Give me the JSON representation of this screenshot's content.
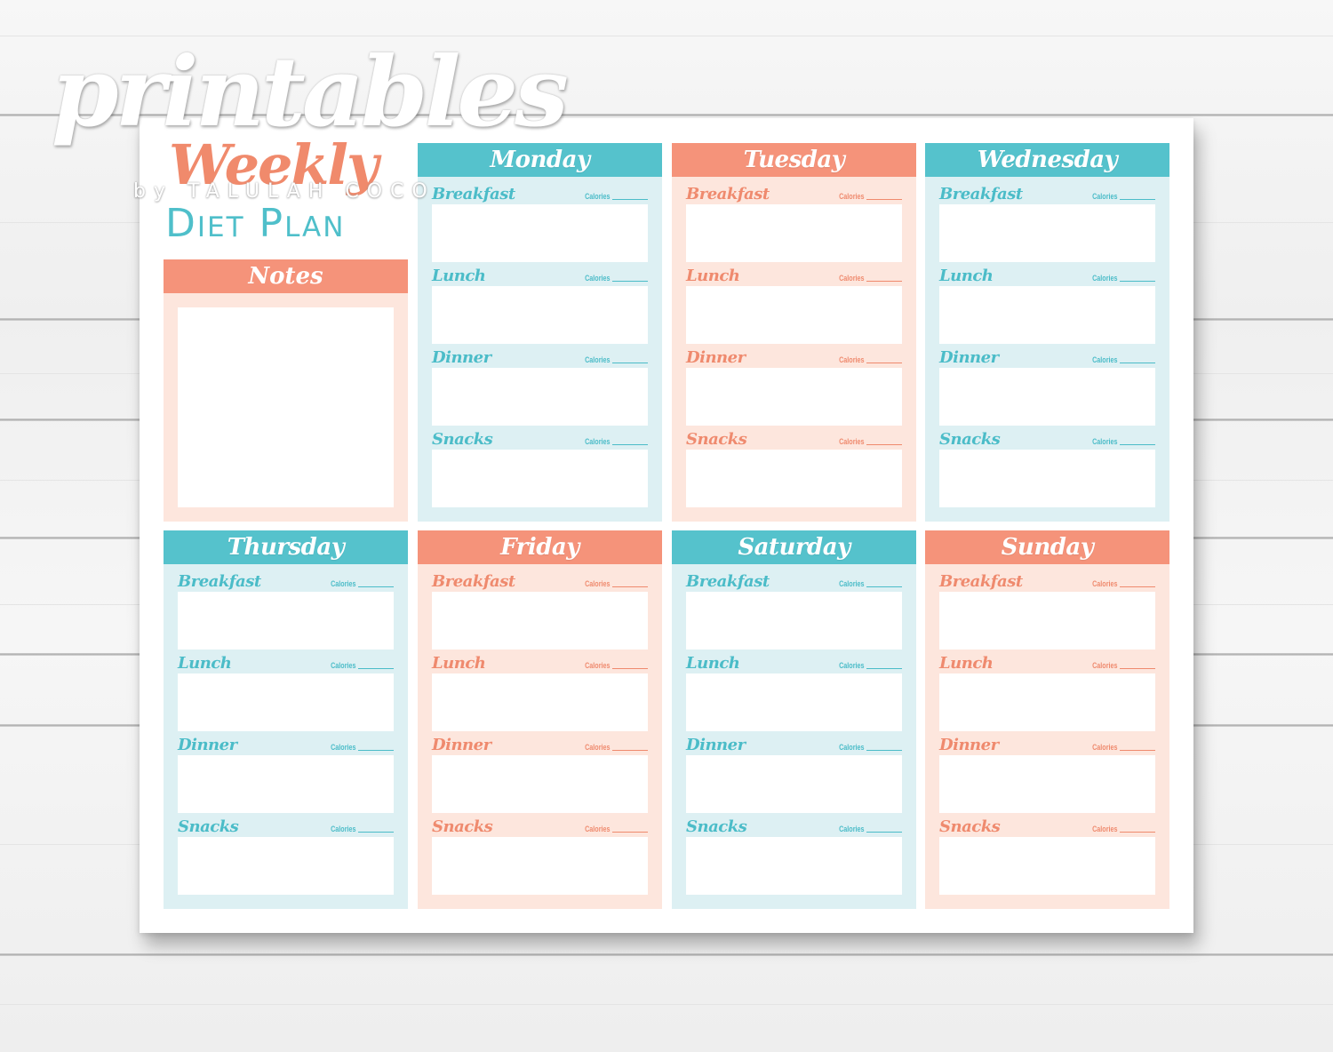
{
  "logo": {
    "brand": "printables",
    "subtitle": "Weekly",
    "byline": "by TALULAH COCO",
    "title": "Diet Plan"
  },
  "notes": {
    "label": "Notes"
  },
  "calories_label": "Calories",
  "meals": [
    "Breakfast",
    "Lunch",
    "Dinner",
    "Snacks"
  ],
  "colors": {
    "teal_header": "#55c2cc",
    "teal_background": "#ddf0f3",
    "teal_text": "#4bbcc8",
    "coral_header": "#f5937a",
    "coral_background": "#fde6dd",
    "coral_text": "#ef8a6e"
  },
  "days": [
    {
      "name": "Monday",
      "theme": "teal"
    },
    {
      "name": "Tuesday",
      "theme": "coral"
    },
    {
      "name": "Wednesday",
      "theme": "teal"
    },
    {
      "name": "Thursday",
      "theme": "teal"
    },
    {
      "name": "Friday",
      "theme": "coral"
    },
    {
      "name": "Saturday",
      "theme": "teal"
    },
    {
      "name": "Sunday",
      "theme": "coral"
    }
  ]
}
